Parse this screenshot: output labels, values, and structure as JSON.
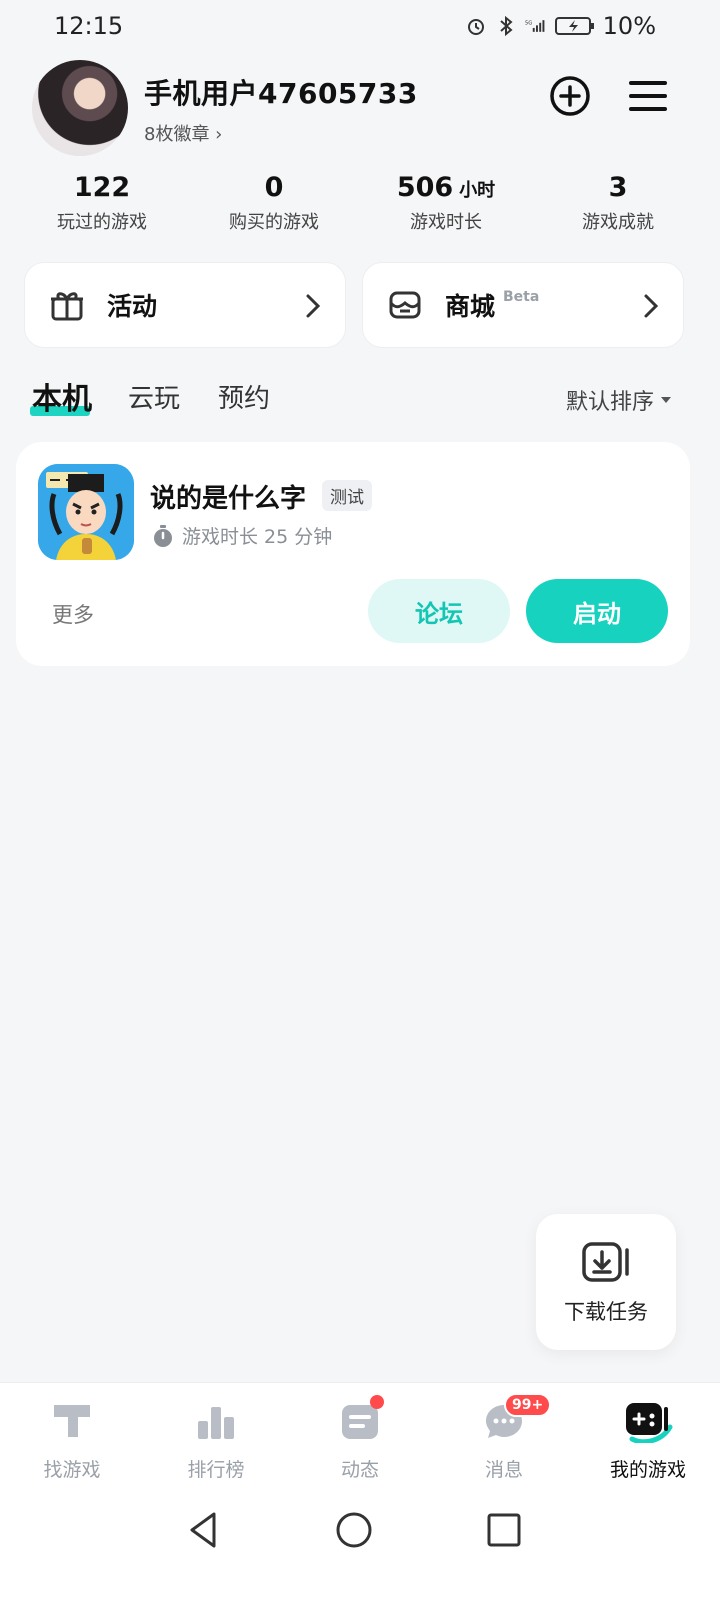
{
  "status_bar": {
    "time": "12:15",
    "battery": "10%",
    "icons": [
      "alarm-icon",
      "bluetooth-icon",
      "5g-signal-icon",
      "battery-charging-icon"
    ]
  },
  "profile": {
    "username": "手机用户47605733",
    "badges": "8枚徽章 ›"
  },
  "stats": [
    {
      "value": "122",
      "unit": "",
      "label": "玩过的游戏"
    },
    {
      "value": "0",
      "unit": "",
      "label": "购买的游戏"
    },
    {
      "value": "506",
      "unit": "小时",
      "label": "游戏时长"
    },
    {
      "value": "3",
      "unit": "",
      "label": "游戏成就"
    }
  ],
  "cards": {
    "activity": {
      "label": "活动",
      "icon": "gift-icon"
    },
    "store": {
      "label": "商城",
      "tag": "Beta",
      "icon": "store-icon"
    }
  },
  "tabs": {
    "local": "本机",
    "cloud": "云玩",
    "reserve": "预约",
    "sort": "默认排序"
  },
  "game": {
    "title": "说的是什么字",
    "tag": "测试",
    "playtime": "游戏时长 25 分钟",
    "more": "更多",
    "forum": "论坛",
    "start": "启动"
  },
  "fab": {
    "label": "下载任务"
  },
  "bottom_nav": [
    {
      "label": "找游戏",
      "icon": "find-games-icon"
    },
    {
      "label": "排行榜",
      "icon": "ranking-icon"
    },
    {
      "label": "动态",
      "icon": "feed-icon"
    },
    {
      "label": "消息",
      "icon": "message-icon",
      "badge": "99+"
    },
    {
      "label": "我的游戏",
      "icon": "my-games-icon"
    }
  ],
  "colors": {
    "accent": "#16d2bf",
    "background": "#f5f6f8",
    "badge_red": "#ff4b4b"
  }
}
